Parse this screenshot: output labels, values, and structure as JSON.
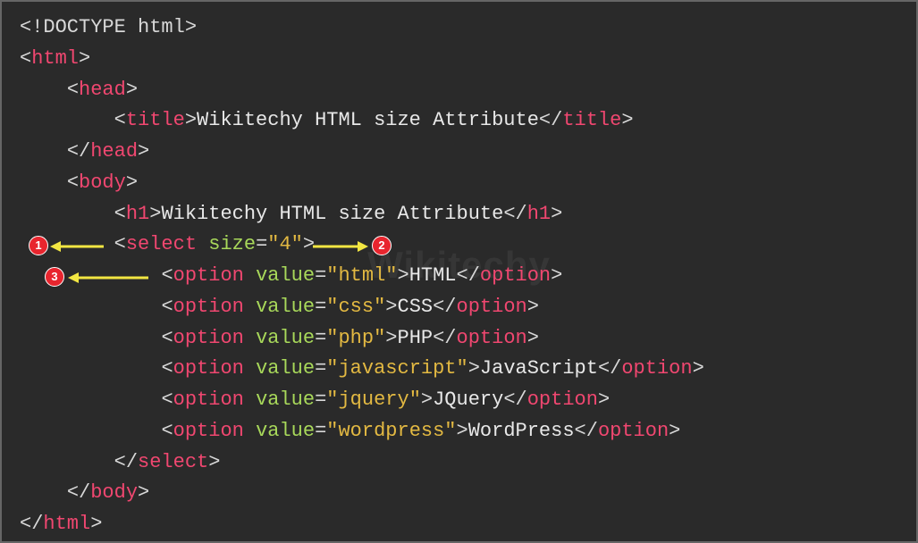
{
  "code": {
    "line1_doctype": "<!DOCTYPE html>",
    "line2_open": "html",
    "line3_open": "head",
    "line4_tag": "title",
    "line4_text": "Wikitechy HTML size Attribute",
    "line5_close": "head",
    "line6_open": "body",
    "line7_tag": "h1",
    "line7_text": "Wikitechy HTML size Attribute",
    "line8_tag": "select",
    "line8_attr": "size",
    "line8_val": "\"4\"",
    "opt_tag": "option",
    "opt_attr": "value",
    "opt1_val": "\"html\"",
    "opt1_text": "HTML",
    "opt2_val": "\"css\"",
    "opt2_text": "CSS",
    "opt3_val": "\"php\"",
    "opt3_text": "PHP",
    "opt4_val": "\"javascript\"",
    "opt4_text": "JavaScript",
    "opt5_val": "\"jquery\"",
    "opt5_text": "JQuery",
    "opt6_val": "\"wordpress\"",
    "opt6_text": "WordPress",
    "line15_close": "select",
    "line16_close": "body",
    "line17_close": "html"
  },
  "annotations": {
    "badge1": "1",
    "badge2": "2",
    "badge3": "3"
  },
  "watermark": "Wikitechy"
}
